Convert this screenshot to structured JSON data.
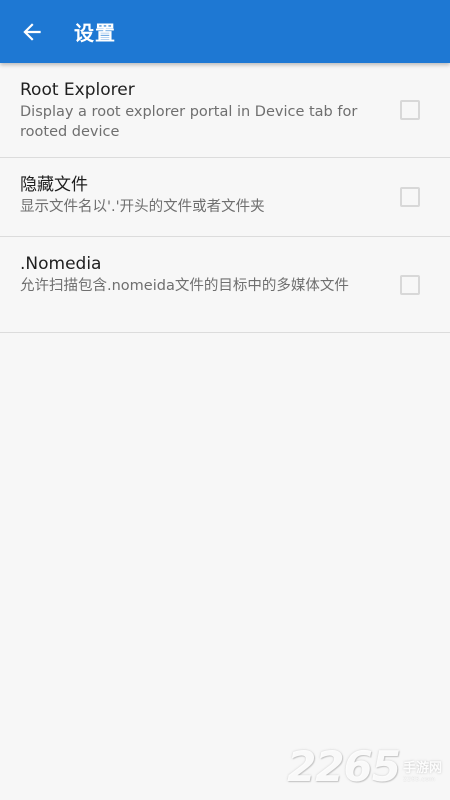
{
  "toolbar": {
    "title": "设置",
    "back_icon": "arrow-left-icon",
    "background_color": "#1e78d3"
  },
  "settings": [
    {
      "title": "Root Explorer",
      "summary": "Display a root explorer portal in Device tab for rooted device",
      "checked": false
    },
    {
      "title": "隐藏文件",
      "summary": "显示文件名以'.'开头的文件或者文件夹",
      "checked": false
    },
    {
      "title": ".Nomedia",
      "summary": "允许扫描包含.nomeida文件的目标中的多媒体文件",
      "checked": false
    }
  ],
  "watermark": {
    "number": "2265",
    "text": "手游网",
    "url": "2265.com"
  }
}
